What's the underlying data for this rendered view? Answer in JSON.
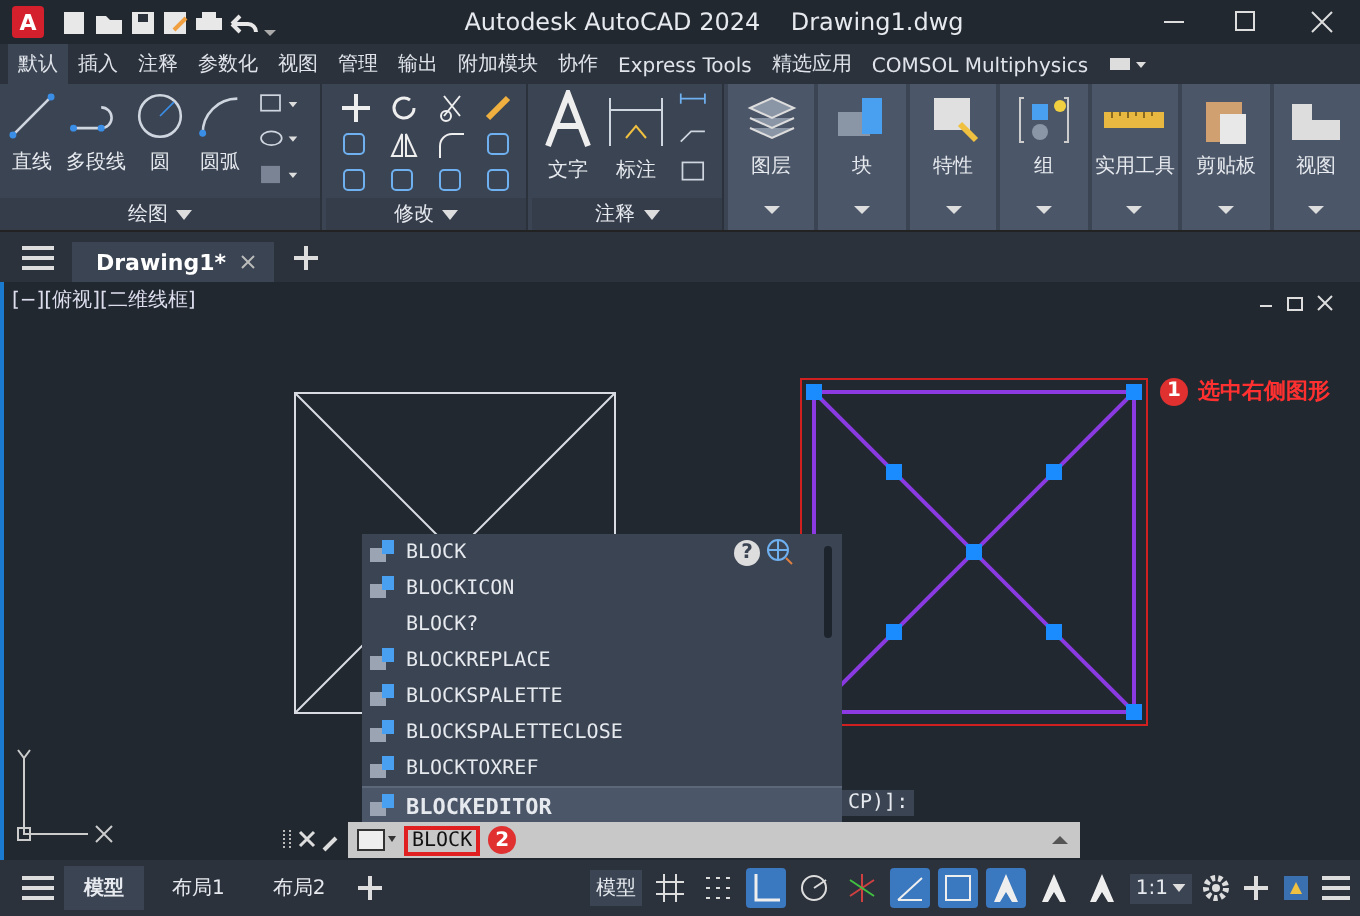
{
  "window": {
    "logo": "A",
    "title": "Autodesk AutoCAD 2024",
    "file": "Drawing1.dwg"
  },
  "ribbon_tabs": [
    {
      "label": "默认",
      "selected": true
    },
    {
      "label": "插入",
      "selected": false
    },
    {
      "label": "注释",
      "selected": false
    },
    {
      "label": "参数化",
      "selected": false
    },
    {
      "label": "视图",
      "selected": false
    },
    {
      "label": "管理",
      "selected": false
    },
    {
      "label": "输出",
      "selected": false
    },
    {
      "label": "附加模块",
      "selected": false
    },
    {
      "label": "协作",
      "selected": false
    },
    {
      "label": "Express Tools",
      "selected": false
    },
    {
      "label": "精选应用",
      "selected": false
    },
    {
      "label": "COMSOL Multiphysics",
      "selected": false
    }
  ],
  "draw_panel": {
    "title": "绘图",
    "tools": [
      {
        "kind": "line",
        "label": "直线"
      },
      {
        "kind": "polyline",
        "label": "多段线"
      },
      {
        "kind": "circle",
        "label": "圆"
      },
      {
        "kind": "arc",
        "label": "圆弧"
      }
    ]
  },
  "modify_panel": {
    "title": "修改"
  },
  "annotation_panel": {
    "title": "注释",
    "tools": [
      {
        "kind": "text",
        "label": "文字"
      },
      {
        "kind": "dimension",
        "label": "标注"
      }
    ]
  },
  "large_buttons": [
    {
      "kind": "layers",
      "label": "图层"
    },
    {
      "kind": "block",
      "label": "块"
    },
    {
      "kind": "properties",
      "label": "特性"
    },
    {
      "kind": "group",
      "label": "组"
    },
    {
      "kind": "utilities",
      "label": "实用工具"
    },
    {
      "kind": "clipboard",
      "label": "剪贴板"
    },
    {
      "kind": "view",
      "label": "视图"
    }
  ],
  "document_tabs": [
    {
      "label": "Drawing1*",
      "selected": true
    }
  ],
  "viewport_label": "[−][俯视][二维线框]",
  "callouts": [
    {
      "number": "1",
      "text": "选中右侧图形"
    },
    {
      "number": "2"
    }
  ],
  "autocomplete": {
    "items": [
      {
        "label": "BLOCK",
        "has_icon": true,
        "selected": false
      },
      {
        "label": "BLOCKICON",
        "has_icon": true,
        "selected": false
      },
      {
        "label": "BLOCK?",
        "has_icon": false,
        "selected": false
      },
      {
        "label": "BLOCKREPLACE",
        "has_icon": true,
        "selected": false
      },
      {
        "label": "BLOCKSPALETTE",
        "has_icon": true,
        "selected": false
      },
      {
        "label": "BLOCKSPALETTECLOSE",
        "has_icon": true,
        "selected": false
      },
      {
        "label": "BLOCKTOXREF",
        "has_icon": true,
        "selected": false
      },
      {
        "label": "BLOCKEDITOR",
        "has_icon": true,
        "selected": true
      }
    ],
    "help": "?"
  },
  "prompt_tail": "CP)]:",
  "command_line": {
    "value": "BLOCK"
  },
  "layout_tabs": [
    {
      "label": "模型",
      "selected": true
    },
    {
      "label": "布局1",
      "selected": false
    },
    {
      "label": "布局2",
      "selected": false
    }
  ],
  "status_bar": {
    "model_button": "模型",
    "scale": "1:1",
    "toggles": [
      {
        "kind": "grid",
        "on": false
      },
      {
        "kind": "snap",
        "on": false
      },
      {
        "kind": "ortho",
        "on": true
      },
      {
        "kind": "polar",
        "on": false
      },
      {
        "kind": "isodraft",
        "on": false
      },
      {
        "kind": "track",
        "on": true
      },
      {
        "kind": "osnap",
        "on": true
      },
      {
        "kind": "annovisible",
        "on": true
      },
      {
        "kind": "annoauto",
        "on": false
      },
      {
        "kind": "annoscale",
        "on": false
      }
    ]
  }
}
